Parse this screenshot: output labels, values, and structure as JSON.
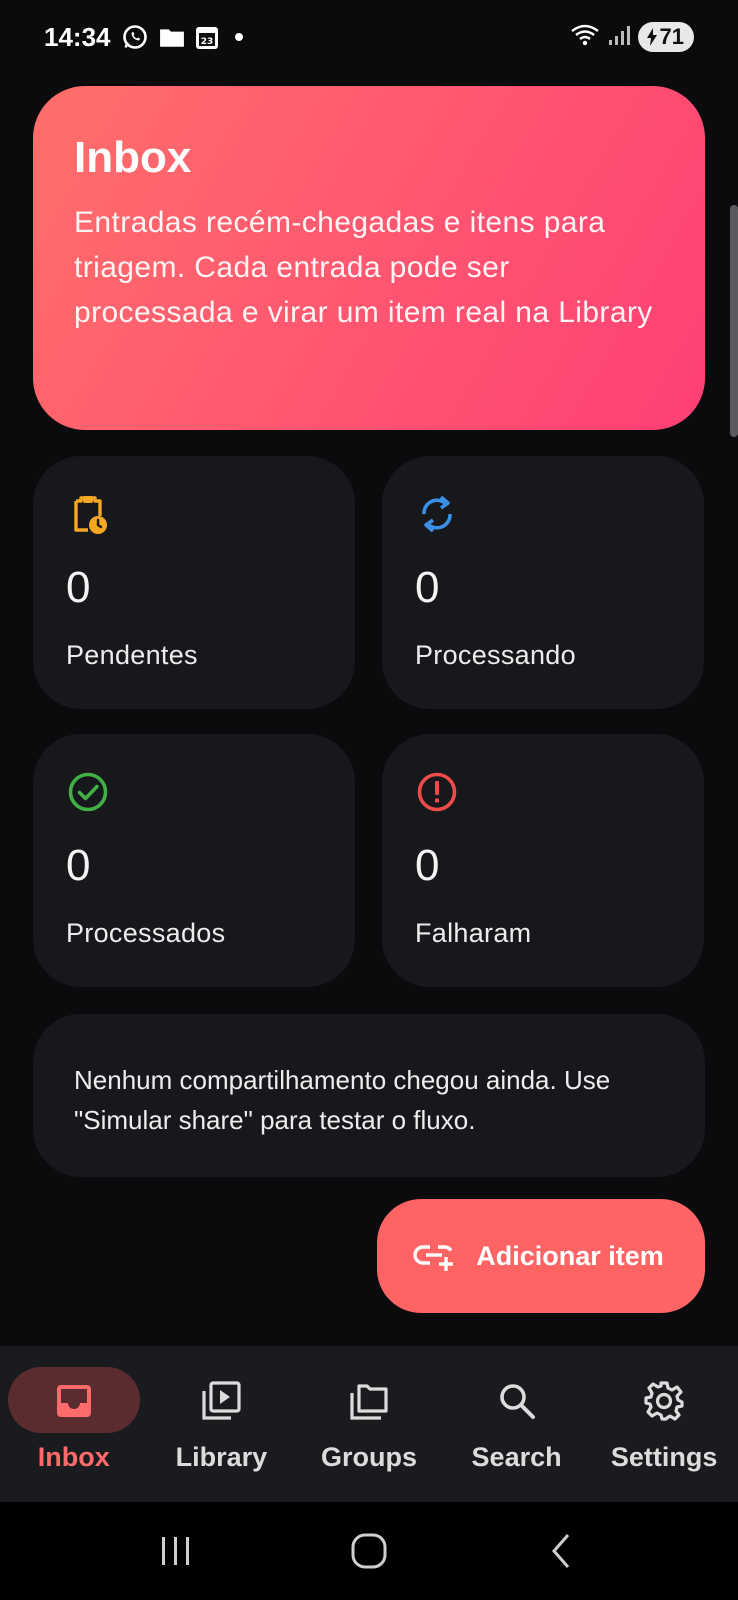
{
  "status_bar": {
    "time": "14:34",
    "calendar_day": "23",
    "battery": "71"
  },
  "hero": {
    "title": "Inbox",
    "description": "Entradas recém-chegadas e itens para triagem. Cada entrada pode ser processada e virar um item real na Library"
  },
  "stats": [
    {
      "value": "0",
      "label": "Pendentes",
      "icon": "clipboard-clock-icon",
      "color": "#f5a623"
    },
    {
      "value": "0",
      "label": "Processando",
      "icon": "sync-icon",
      "color": "#3b8fe6"
    },
    {
      "value": "0",
      "label": "Processados",
      "icon": "check-circle-icon",
      "color": "#43b047"
    },
    {
      "value": "0",
      "label": "Falharam",
      "icon": "error-circle-icon",
      "color": "#ef4b4b"
    }
  ],
  "empty_state": {
    "text": "Nenhum compartilhamento chegou ainda. Use \"Simular share\" para testar o fluxo."
  },
  "fab": {
    "label": "Adicionar item",
    "icon": "add-link-icon"
  },
  "nav": {
    "items": [
      {
        "label": "Inbox",
        "icon": "inbox-icon",
        "active": true
      },
      {
        "label": "Library",
        "icon": "video-library-icon",
        "active": false
      },
      {
        "label": "Groups",
        "icon": "folders-icon",
        "active": false
      },
      {
        "label": "Search",
        "icon": "search-icon",
        "active": false
      },
      {
        "label": "Settings",
        "icon": "gear-icon",
        "active": false
      }
    ]
  },
  "colors": {
    "accent": "#ff6464",
    "active_nav": "#ff6b6b",
    "card_bg": "#17181b"
  }
}
